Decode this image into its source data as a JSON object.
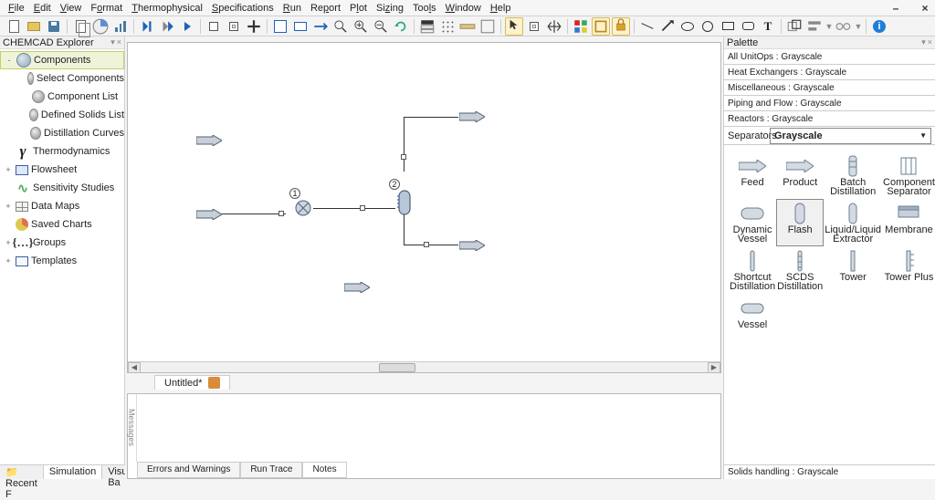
{
  "menu": {
    "items": [
      "File",
      "Edit",
      "View",
      "Format",
      "Thermophysical",
      "Specifications",
      "Run",
      "Report",
      "Plot",
      "Sizing",
      "Tools",
      "Window",
      "Help"
    ]
  },
  "explorer": {
    "title": "CHEMCAD Explorer",
    "nodes": [
      {
        "label": "Components",
        "icon": "globe",
        "sel": true,
        "exp": "-"
      },
      {
        "label": "Select Components",
        "icon": "ball",
        "indent": 1
      },
      {
        "label": "Component List",
        "icon": "ball",
        "indent": 1
      },
      {
        "label": "Defined Solids List",
        "icon": "ball",
        "indent": 1
      },
      {
        "label": "Distillation Curves",
        "icon": "ball",
        "indent": 1
      },
      {
        "label": "Thermodynamics",
        "icon": "gamma"
      },
      {
        "label": "Flowsheet",
        "icon": "flow",
        "exp": "+"
      },
      {
        "label": "Sensitivity Studies",
        "icon": "wave"
      },
      {
        "label": "Data Maps",
        "icon": "grid",
        "exp": "+"
      },
      {
        "label": "Saved Charts",
        "icon": "pie"
      },
      {
        "label": "Groups",
        "icon": "braces",
        "exp": "+"
      },
      {
        "label": "Templates",
        "icon": "tpl",
        "exp": "+"
      }
    ],
    "tabs": [
      "Recent F",
      "Simulation",
      "Visual Ba"
    ]
  },
  "canvas": {
    "doc_tab": "Untitled*",
    "unit_tag_1": "1",
    "unit_tag_2": "2"
  },
  "messages": {
    "side": "Messages",
    "tabs": [
      "Errors and Warnings",
      "Run Trace",
      "Notes"
    ]
  },
  "palette": {
    "title": "Palette",
    "sections": [
      "All UnitOps : Grayscale",
      "Heat Exchangers : Grayscale",
      "Miscellaneous : Grayscale",
      "Piping and Flow : Grayscale",
      "Reactors : Grayscale"
    ],
    "active_label": "Separators",
    "active_value": "Grayscale",
    "items": [
      "Feed",
      "Product",
      "Batch Distillation",
      "Component Separator",
      "Dynamic Vessel",
      "Flash",
      "Liquid/Liquid Extractor",
      "Membrane",
      "Shortcut Distillation",
      "SCDS Distillation",
      "Tower",
      "Tower Plus",
      "Vessel"
    ],
    "status": "Solids handling : Grayscale"
  }
}
